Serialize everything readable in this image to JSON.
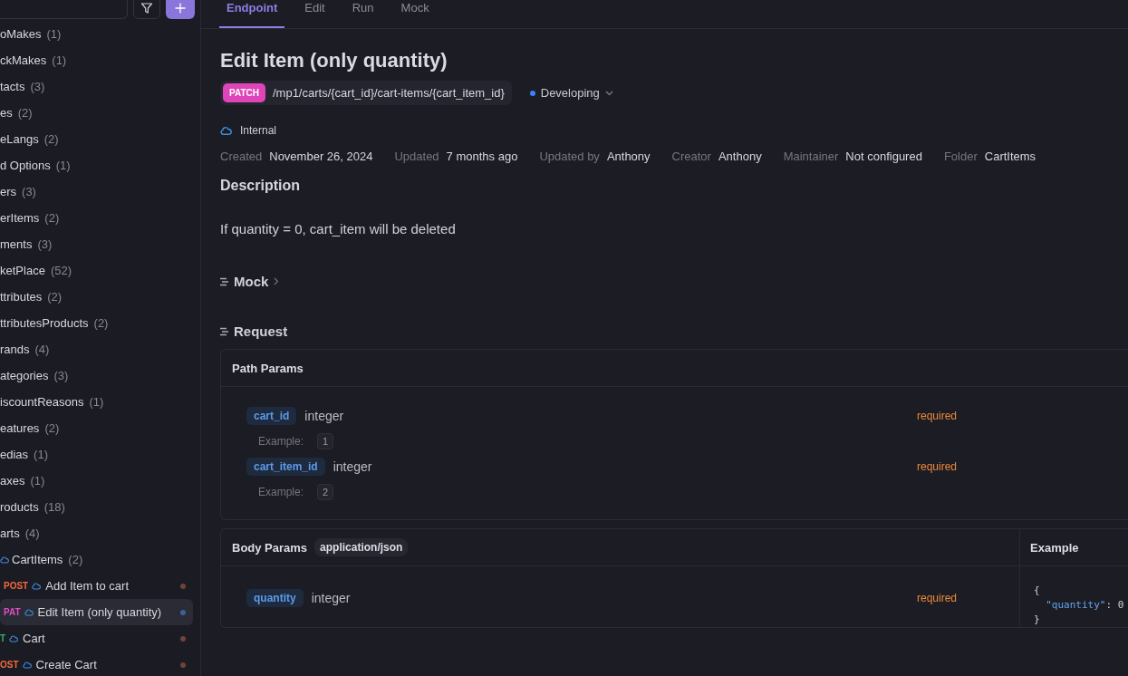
{
  "sidebar": {
    "items": [
      {
        "kind": "folder",
        "name": "oMakes",
        "count": "(1)"
      },
      {
        "kind": "folder",
        "name": "ckMakes",
        "count": "(1)"
      },
      {
        "kind": "folder",
        "name": "tacts",
        "count": "(3)"
      },
      {
        "kind": "folder",
        "name": "es",
        "count": "(2)"
      },
      {
        "kind": "folder",
        "name": "eLangs",
        "count": "(2)"
      },
      {
        "kind": "folder",
        "name": "d Options",
        "count": "(1)"
      },
      {
        "kind": "folder",
        "name": "ers",
        "count": "(3)"
      },
      {
        "kind": "folder",
        "name": "erItems",
        "count": "(2)"
      },
      {
        "kind": "folder",
        "name": "ments",
        "count": "(3)"
      },
      {
        "kind": "folder",
        "name": "ketPlace",
        "count": "(52)"
      },
      {
        "kind": "folder",
        "name": "ttributes",
        "count": "(2)"
      },
      {
        "kind": "folder",
        "name": "ttributesProducts",
        "count": "(2)"
      },
      {
        "kind": "folder",
        "name": "rands",
        "count": "(4)"
      },
      {
        "kind": "folder",
        "name": "ategories",
        "count": "(3)"
      },
      {
        "kind": "folder",
        "name": "iscountReasons",
        "count": "(1)"
      },
      {
        "kind": "folder",
        "name": "eatures",
        "count": "(2)"
      },
      {
        "kind": "folder",
        "name": "edias",
        "count": "(1)"
      },
      {
        "kind": "folder",
        "name": "axes",
        "count": "(1)"
      },
      {
        "kind": "folder",
        "name": "roducts",
        "count": "(18)"
      },
      {
        "kind": "folder",
        "name": "arts",
        "count": "(4)",
        "children": [
          {
            "kind": "internal-folder",
            "name": "CartItems",
            "count": "(2)",
            "children": [
              {
                "kind": "endpoint",
                "method": {
                  "label": "POST",
                  "color": "#f26b3a"
                },
                "name": "Add Item to cart",
                "selected": false,
                "color": "#6e4536"
              },
              {
                "kind": "endpoint",
                "method": {
                  "label": "PAT",
                  "color": "#e04fc3"
                },
                "name": "Edit Item (only quantity)",
                "selected": true,
                "color": "#3d5f9c"
              }
            ]
          },
          {
            "kind": "endpoint",
            "method": {
              "label": "T",
              "color": "#2fb36b"
            },
            "name": "Cart",
            "selected": false,
            "color": "#6e4536"
          },
          {
            "kind": "endpoint",
            "method": {
              "label": "OST",
              "color": "#f26b3a"
            },
            "name": "Create Cart",
            "selected": false,
            "color": "#6e4536"
          }
        ]
      }
    ]
  },
  "tabs": [
    {
      "label": "Endpoint",
      "selected": true
    },
    {
      "label": "Edit",
      "selected": false
    },
    {
      "label": "Run",
      "selected": false
    },
    {
      "label": "Mock",
      "selected": false
    }
  ],
  "endpoint": {
    "title": "Edit Item (only quantity)",
    "method": "PATCH",
    "path": "/mp1/carts/{cart_id}/cart-items/{cart_item_id}",
    "status": "Developing",
    "visibility": "Internal",
    "meta": [
      {
        "label": "Created",
        "value": "November 26, 2024"
      },
      {
        "label": "Updated",
        "value": "7 months ago"
      },
      {
        "label": "Updated by",
        "value": "Anthony"
      },
      {
        "label": "Creator",
        "value": "Anthony"
      },
      {
        "label": "Maintainer",
        "value": "Not configured"
      },
      {
        "label": "Folder",
        "value": "CartItems"
      }
    ],
    "description": {
      "heading": "Description",
      "text": "If quantity = 0, cart_item will be deleted"
    },
    "mock": {
      "heading": "Mock"
    },
    "request": {
      "heading": "Request",
      "path_params": {
        "heading": "Path Params",
        "params": [
          {
            "name": "cart_id",
            "type": "integer",
            "required": "required",
            "example_label": "Example:",
            "example": "1"
          },
          {
            "name": "cart_item_id",
            "type": "integer",
            "required": "required",
            "example_label": "Example:",
            "example": "2"
          }
        ]
      },
      "body_params": {
        "heading": "Body Params",
        "content_type": "application/json",
        "example_heading": "Example",
        "params": [
          {
            "name": "quantity",
            "type": "integer",
            "required": "required"
          }
        ],
        "example_lines": [
          "{",
          "  \"quantity\": 0",
          "}"
        ]
      }
    }
  }
}
